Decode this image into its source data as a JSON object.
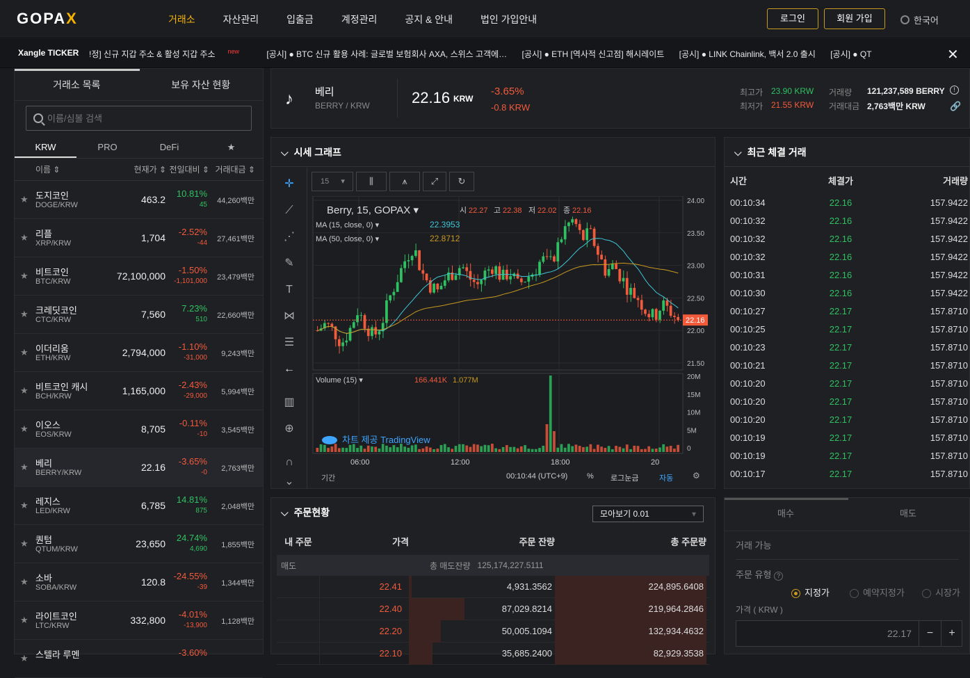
{
  "brand": {
    "logo_text": "GOPA",
    "logo_x": "X"
  },
  "nav": {
    "items": [
      "거래소",
      "자산관리",
      "입출금",
      "계정관리",
      "공지 & 안내",
      "법인 가입안내"
    ],
    "login": "로그인",
    "signup": "회원 가입",
    "language": "한국어"
  },
  "ticker": {
    "brand": "Xangle TICKER",
    "items": [
      "!정] 신규 지갑 주소 & 활성 지갑 주소",
      "[공시] ● BTC  신규 활용 사례: 글로벌 보험회사 AXA, 스위스 고객에…",
      "[공시] ● ETH  [역사적 신고점] 해시레이트",
      "[공시] ● LINK  Chainlink, 백서 2.0 출시",
      "[공시] ● QT"
    ],
    "new_badge": "new"
  },
  "left": {
    "tabs": [
      "거래소 목록",
      "보유 자산 현황"
    ],
    "search_placeholder": "이름/심볼 검색",
    "market_tabs": [
      "KRW",
      "PRO",
      "DeFi",
      "★"
    ],
    "headers": {
      "name": "이름 ⇕",
      "price": "현재가 ⇕",
      "change": "전일대비 ⇕",
      "volume": "거래대금 ⇕"
    },
    "coins": [
      {
        "name": "도지코인",
        "symbol": "DOGE/KRW",
        "price": "463.2",
        "rate": "10.81%",
        "diff": "45",
        "volume": "44,260백만",
        "dir": "up"
      },
      {
        "name": "리플",
        "symbol": "XRP/KRW",
        "price": "1,704",
        "rate": "-2.52%",
        "diff": "-44",
        "volume": "27,461백만",
        "dir": "dn"
      },
      {
        "name": "비트코인",
        "symbol": "BTC/KRW",
        "price": "72,100,000",
        "rate": "-1.50%",
        "diff": "-1,101,000",
        "volume": "23,479백만",
        "dir": "dn"
      },
      {
        "name": "크레딧코인",
        "symbol": "CTC/KRW",
        "price": "7,560",
        "rate": "7.23%",
        "diff": "510",
        "volume": "22,660백만",
        "dir": "up"
      },
      {
        "name": "이더리움",
        "symbol": "ETH/KRW",
        "price": "2,794,000",
        "rate": "-1.10%",
        "diff": "-31,000",
        "volume": "9,243백만",
        "dir": "dn"
      },
      {
        "name": "비트코인 캐시",
        "symbol": "BCH/KRW",
        "price": "1,165,000",
        "rate": "-2.43%",
        "diff": "-29,000",
        "volume": "5,994백만",
        "dir": "dn"
      },
      {
        "name": "이오스",
        "symbol": "EOS/KRW",
        "price": "8,705",
        "rate": "-0.11%",
        "diff": "-10",
        "volume": "3,545백만",
        "dir": "dn"
      },
      {
        "name": "베리",
        "symbol": "BERRY/KRW",
        "price": "22.16",
        "rate": "-3.65%",
        "diff": "-0",
        "volume": "2,763백만",
        "dir": "dn"
      },
      {
        "name": "레지스",
        "symbol": "LED/KRW",
        "price": "6,785",
        "rate": "14.81%",
        "diff": "875",
        "volume": "2,048백만",
        "dir": "up"
      },
      {
        "name": "퀀텀",
        "symbol": "QTUM/KRW",
        "price": "23,650",
        "rate": "24.74%",
        "diff": "4,690",
        "volume": "1,855백만",
        "dir": "up"
      },
      {
        "name": "소바",
        "symbol": "SOBA/KRW",
        "price": "120.8",
        "rate": "-24.55%",
        "diff": "-39",
        "volume": "1,344백만",
        "dir": "dn"
      },
      {
        "name": "라이트코인",
        "symbol": "LTC/KRW",
        "price": "332,800",
        "rate": "-4.01%",
        "diff": "-13,900",
        "volume": "1,128백만",
        "dir": "dn"
      },
      {
        "name": "스텔라 루멘",
        "symbol": "",
        "price": "",
        "rate": "-3.60%",
        "diff": "",
        "volume": "",
        "dir": "dn"
      }
    ]
  },
  "info": {
    "name": "베리",
    "pair": "BERRY / KRW",
    "price": "22.16",
    "unit": "KRW",
    "rate": "-3.65%",
    "diff": "-0.8 KRW",
    "high_label": "최고가",
    "high": "23.90 KRW",
    "low_label": "최저가",
    "low": "21.55 KRW",
    "vol_label": "거래량",
    "vol": "121,237,589 BERRY",
    "amt_label": "거래대금",
    "amt": "2,763백만 KRW"
  },
  "chart": {
    "title": "시세 그래프",
    "interval": "15",
    "legend_main": "Berry, 15, GOPAX",
    "ohlc": {
      "o_label": "시",
      "o": "22.27",
      "h_label": "고",
      "h": "22.38",
      "l_label": "저",
      "l": "22.02",
      "c_label": "종",
      "c": "22.16"
    },
    "ma15_label": "MA (15, close, 0)",
    "ma15": "22.3953",
    "ma50_label": "MA (50, close, 0)",
    "ma50": "22.8712",
    "volume_label": "Volume (15)",
    "vol_a": "166.441K",
    "vol_b": "1.077M",
    "credit": "차트 제공 TradingView",
    "price_ticks": [
      "24.00",
      "23.50",
      "23.00",
      "22.50",
      "22.00",
      "21.50"
    ],
    "vol_ticks": [
      "20M",
      "15M",
      "10M",
      "5M",
      "0"
    ],
    "time_ticks": [
      "06:00",
      "12:00",
      "18:00",
      "20"
    ],
    "last_price": "22.16",
    "footer_left": "기간",
    "footer_time": "00:10:44 (UTC+9)",
    "footer_pct": "%",
    "footer_log": "로그눈금",
    "footer_auto": "자동"
  },
  "chart_data": {
    "type": "candlestick",
    "ylim": [
      21.5,
      24.0
    ],
    "last": 22.16
  },
  "trades": {
    "title": "최근 체결 거래",
    "headers": [
      "시간",
      "체결가",
      "거래량"
    ],
    "rows": [
      [
        "00:10:34",
        "22.16",
        "157.9422",
        "up"
      ],
      [
        "00:10:32",
        "22.16",
        "157.9422",
        "up"
      ],
      [
        "00:10:32",
        "22.16",
        "157.9422",
        "up"
      ],
      [
        "00:10:32",
        "22.16",
        "157.9422",
        "up"
      ],
      [
        "00:10:31",
        "22.16",
        "157.9422",
        "up"
      ],
      [
        "00:10:30",
        "22.16",
        "157.9422",
        "up"
      ],
      [
        "00:10:27",
        "22.17",
        "157.8710",
        "up"
      ],
      [
        "00:10:25",
        "22.17",
        "157.8710",
        "up"
      ],
      [
        "00:10:23",
        "22.17",
        "157.8710",
        "up"
      ],
      [
        "00:10:21",
        "22.17",
        "157.8710",
        "up"
      ],
      [
        "00:10:20",
        "22.17",
        "157.8710",
        "up"
      ],
      [
        "00:10:20",
        "22.17",
        "157.8710",
        "up"
      ],
      [
        "00:10:20",
        "22.17",
        "157.8710",
        "up"
      ],
      [
        "00:10:19",
        "22.17",
        "157.8710",
        "up"
      ],
      [
        "00:10:19",
        "22.17",
        "157.8710",
        "up"
      ],
      [
        "00:10:17",
        "22.17",
        "157.8710",
        "up"
      ]
    ]
  },
  "orderbook": {
    "title": "주문현황",
    "group_select": "모아보기 0.01",
    "headers": [
      "내 주문",
      "가격",
      "주문 잔량",
      "총 주문량"
    ],
    "sell_label": "매도",
    "sell_total_label": "총 매도잔량",
    "sell_total": "125,174,227.5111",
    "rows": [
      {
        "price": "22.41",
        "qty": "4,931.3562",
        "total": "224,895.6408",
        "bar": 0.02
      },
      {
        "price": "22.40",
        "qty": "87,029.8214",
        "total": "219,964.2846",
        "bar": 0.38
      },
      {
        "price": "22.20",
        "qty": "50,005.1094",
        "total": "132,934.4632",
        "bar": 0.22
      },
      {
        "price": "22.10",
        "qty": "35,685.2400",
        "total": "82,929.3538",
        "bar": 0.16
      }
    ]
  },
  "order": {
    "tabs": [
      "매수",
      "매도"
    ],
    "available": "거래 가능",
    "type_label": "주문 유형",
    "types": [
      "지정가",
      "예약지정가",
      "시장가"
    ],
    "price_label": "가격 ( KRW )",
    "price_value": "22.17",
    "minus": "−",
    "plus": "+"
  },
  "colors": {
    "accent": "#f5b300",
    "up": "#2fc161",
    "down": "#f25a3c",
    "ma15": "#3ec7d6",
    "ma50": "#c99a1e"
  }
}
